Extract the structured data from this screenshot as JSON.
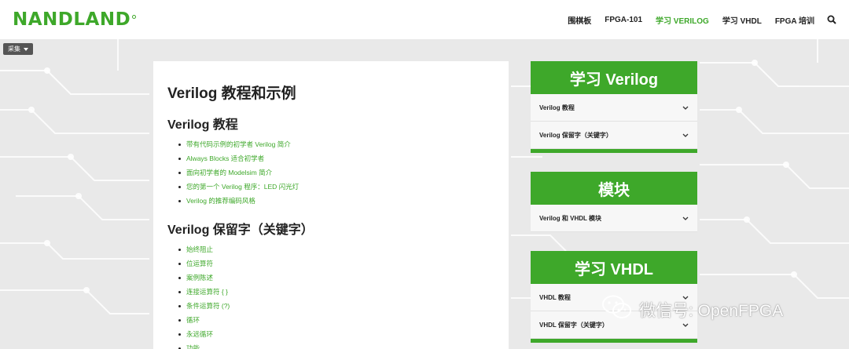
{
  "header": {
    "logo_text": "NANDLAND",
    "nav": [
      {
        "label": "围棋板",
        "active": false
      },
      {
        "label": "FPGA-101",
        "active": false
      },
      {
        "label": "学习 VERILOG",
        "active": true
      },
      {
        "label": "学习 VHDL",
        "active": false
      },
      {
        "label": "FPGA 培训",
        "active": false
      }
    ],
    "search_icon": "search-icon"
  },
  "toolbar": {
    "collect_label": "采集"
  },
  "main": {
    "title": "Verilog 教程和示例",
    "tutorials": {
      "heading": "Verilog 教程",
      "items": [
        "带有代码示例的初学者 Verilog 简介",
        "Always Blocks 适合初学者",
        "面向初学者的 Modelsim 简介",
        "您的第一个 Verilog 程序：LED 闪光灯",
        "Verilog 的推荐编码风格"
      ]
    },
    "keywords": {
      "heading": "Verilog 保留字（关键字）",
      "items": [
        "始终阻止",
        "位运算符",
        "案例陈述",
        "连接运算符 { }",
        "条件运算符 (?)",
        "循环",
        "永远循环",
        "功能"
      ]
    }
  },
  "sidebar": {
    "verilog": {
      "title": "学习 Verilog",
      "rows": [
        "Verilog 教程",
        "Verilog 保留字（关键字）"
      ]
    },
    "modules": {
      "title": "模块",
      "rows": [
        "Verilog 和 VHDL 模块"
      ]
    },
    "vhdl": {
      "title": "学习 VHDL",
      "rows": [
        "VHDL 教程",
        "VHDL 保留字（关键字）"
      ]
    }
  },
  "watermark": {
    "text": "微信号: OpenFPGA"
  },
  "colors": {
    "accent": "#3ea82a",
    "background": "#e9e9e9"
  }
}
